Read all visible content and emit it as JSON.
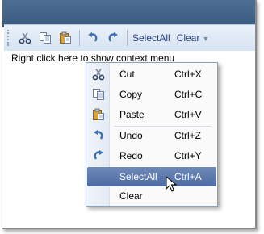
{
  "toolbar": {
    "buttons": [
      {
        "name": "cut-button",
        "icon": "scissors-icon"
      },
      {
        "name": "copy-button",
        "icon": "copy-icon"
      },
      {
        "name": "paste-button",
        "icon": "paste-icon"
      },
      {
        "name": "undo-button",
        "icon": "undo-icon"
      },
      {
        "name": "redo-button",
        "icon": "redo-icon"
      }
    ],
    "select_all_label": "SelectAll",
    "clear_label": "Clear"
  },
  "workspace": {
    "hint": "Right click here to show context menu"
  },
  "context_menu": {
    "items": [
      {
        "label": "Cut",
        "shortcut": "Ctrl+X",
        "icon": "scissors-icon"
      },
      {
        "label": "Copy",
        "shortcut": "Ctrl+C",
        "icon": "copy-icon"
      },
      {
        "label": "Paste",
        "shortcut": "Ctrl+V",
        "icon": "paste-icon"
      },
      {
        "label": "Undo",
        "shortcut": "Ctrl+Z",
        "icon": "undo-icon"
      },
      {
        "label": "Redo",
        "shortcut": "Ctrl+Y",
        "icon": "redo-icon"
      },
      {
        "label": "SelectAll",
        "shortcut": "Ctrl+A",
        "icon": ""
      },
      {
        "label": "Clear",
        "shortcut": "",
        "icon": ""
      }
    ],
    "highlighted_item": "SelectAll"
  },
  "colors": {
    "accent": "#4d6ba2",
    "toolbar_text": "#27407a",
    "titlebar": "#39597f"
  }
}
